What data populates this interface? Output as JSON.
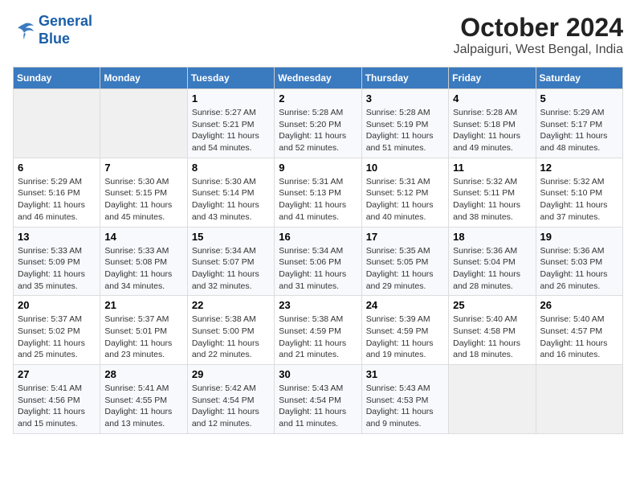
{
  "logo": {
    "line1": "General",
    "line2": "Blue"
  },
  "title": "October 2024",
  "subtitle": "Jalpaiguri, West Bengal, India",
  "days_of_week": [
    "Sunday",
    "Monday",
    "Tuesday",
    "Wednesday",
    "Thursday",
    "Friday",
    "Saturday"
  ],
  "weeks": [
    [
      {
        "day": "",
        "info": ""
      },
      {
        "day": "",
        "info": ""
      },
      {
        "day": "1",
        "info": "Sunrise: 5:27 AM\nSunset: 5:21 PM\nDaylight: 11 hours and 54 minutes."
      },
      {
        "day": "2",
        "info": "Sunrise: 5:28 AM\nSunset: 5:20 PM\nDaylight: 11 hours and 52 minutes."
      },
      {
        "day": "3",
        "info": "Sunrise: 5:28 AM\nSunset: 5:19 PM\nDaylight: 11 hours and 51 minutes."
      },
      {
        "day": "4",
        "info": "Sunrise: 5:28 AM\nSunset: 5:18 PM\nDaylight: 11 hours and 49 minutes."
      },
      {
        "day": "5",
        "info": "Sunrise: 5:29 AM\nSunset: 5:17 PM\nDaylight: 11 hours and 48 minutes."
      }
    ],
    [
      {
        "day": "6",
        "info": "Sunrise: 5:29 AM\nSunset: 5:16 PM\nDaylight: 11 hours and 46 minutes."
      },
      {
        "day": "7",
        "info": "Sunrise: 5:30 AM\nSunset: 5:15 PM\nDaylight: 11 hours and 45 minutes."
      },
      {
        "day": "8",
        "info": "Sunrise: 5:30 AM\nSunset: 5:14 PM\nDaylight: 11 hours and 43 minutes."
      },
      {
        "day": "9",
        "info": "Sunrise: 5:31 AM\nSunset: 5:13 PM\nDaylight: 11 hours and 41 minutes."
      },
      {
        "day": "10",
        "info": "Sunrise: 5:31 AM\nSunset: 5:12 PM\nDaylight: 11 hours and 40 minutes."
      },
      {
        "day": "11",
        "info": "Sunrise: 5:32 AM\nSunset: 5:11 PM\nDaylight: 11 hours and 38 minutes."
      },
      {
        "day": "12",
        "info": "Sunrise: 5:32 AM\nSunset: 5:10 PM\nDaylight: 11 hours and 37 minutes."
      }
    ],
    [
      {
        "day": "13",
        "info": "Sunrise: 5:33 AM\nSunset: 5:09 PM\nDaylight: 11 hours and 35 minutes."
      },
      {
        "day": "14",
        "info": "Sunrise: 5:33 AM\nSunset: 5:08 PM\nDaylight: 11 hours and 34 minutes."
      },
      {
        "day": "15",
        "info": "Sunrise: 5:34 AM\nSunset: 5:07 PM\nDaylight: 11 hours and 32 minutes."
      },
      {
        "day": "16",
        "info": "Sunrise: 5:34 AM\nSunset: 5:06 PM\nDaylight: 11 hours and 31 minutes."
      },
      {
        "day": "17",
        "info": "Sunrise: 5:35 AM\nSunset: 5:05 PM\nDaylight: 11 hours and 29 minutes."
      },
      {
        "day": "18",
        "info": "Sunrise: 5:36 AM\nSunset: 5:04 PM\nDaylight: 11 hours and 28 minutes."
      },
      {
        "day": "19",
        "info": "Sunrise: 5:36 AM\nSunset: 5:03 PM\nDaylight: 11 hours and 26 minutes."
      }
    ],
    [
      {
        "day": "20",
        "info": "Sunrise: 5:37 AM\nSunset: 5:02 PM\nDaylight: 11 hours and 25 minutes."
      },
      {
        "day": "21",
        "info": "Sunrise: 5:37 AM\nSunset: 5:01 PM\nDaylight: 11 hours and 23 minutes."
      },
      {
        "day": "22",
        "info": "Sunrise: 5:38 AM\nSunset: 5:00 PM\nDaylight: 11 hours and 22 minutes."
      },
      {
        "day": "23",
        "info": "Sunrise: 5:38 AM\nSunset: 4:59 PM\nDaylight: 11 hours and 21 minutes."
      },
      {
        "day": "24",
        "info": "Sunrise: 5:39 AM\nSunset: 4:59 PM\nDaylight: 11 hours and 19 minutes."
      },
      {
        "day": "25",
        "info": "Sunrise: 5:40 AM\nSunset: 4:58 PM\nDaylight: 11 hours and 18 minutes."
      },
      {
        "day": "26",
        "info": "Sunrise: 5:40 AM\nSunset: 4:57 PM\nDaylight: 11 hours and 16 minutes."
      }
    ],
    [
      {
        "day": "27",
        "info": "Sunrise: 5:41 AM\nSunset: 4:56 PM\nDaylight: 11 hours and 15 minutes."
      },
      {
        "day": "28",
        "info": "Sunrise: 5:41 AM\nSunset: 4:55 PM\nDaylight: 11 hours and 13 minutes."
      },
      {
        "day": "29",
        "info": "Sunrise: 5:42 AM\nSunset: 4:54 PM\nDaylight: 11 hours and 12 minutes."
      },
      {
        "day": "30",
        "info": "Sunrise: 5:43 AM\nSunset: 4:54 PM\nDaylight: 11 hours and 11 minutes."
      },
      {
        "day": "31",
        "info": "Sunrise: 5:43 AM\nSunset: 4:53 PM\nDaylight: 11 hours and 9 minutes."
      },
      {
        "day": "",
        "info": ""
      },
      {
        "day": "",
        "info": ""
      }
    ]
  ]
}
